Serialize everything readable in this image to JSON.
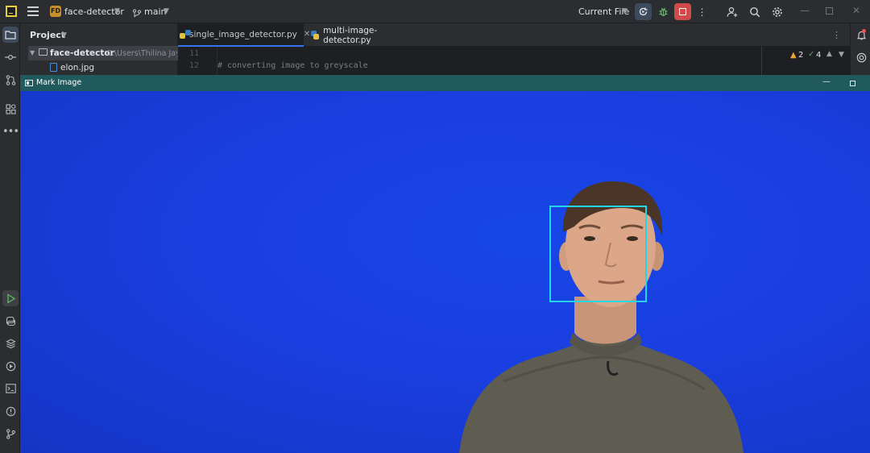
{
  "titlebar": {
    "project_badge": "FD",
    "project_name": "face-detector",
    "branch": "main",
    "run_config": "Current File"
  },
  "project_panel": {
    "title": "Project",
    "root_name": "face-detector",
    "root_path": "C:\\Users\\Thilina Jay...",
    "file": "elon.jpg"
  },
  "editor": {
    "tabs": [
      {
        "label": "single_image_detector.py",
        "active": true
      },
      {
        "label": "multi-image-detector.py",
        "active": false
      }
    ],
    "lines": [
      {
        "number": "11",
        "text": ""
      },
      {
        "number": "12",
        "text": "# converting image to greyscale"
      }
    ],
    "inspections": {
      "warnings": "2",
      "ok": "4"
    }
  },
  "image_window": {
    "title": "Mark Image"
  },
  "colors": {
    "accent": "#3574f0",
    "face_box": "#22d6e6",
    "image_bg": "#1a3ee0",
    "stop": "#cf4a4a"
  }
}
